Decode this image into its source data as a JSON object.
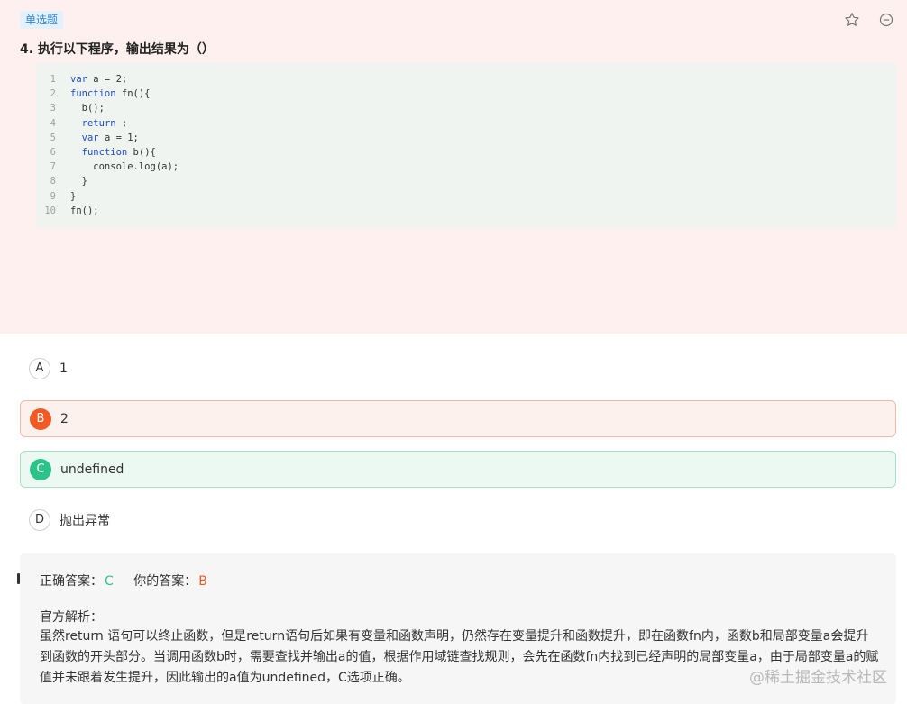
{
  "question": {
    "type_tag": "单选题",
    "title": "4. 执行以下程序，输出结果为（）",
    "code_lines": [
      {
        "num": "1",
        "text": "var a = 2;"
      },
      {
        "num": "2",
        "text": "function fn(){"
      },
      {
        "num": "3",
        "text": "  b();"
      },
      {
        "num": "4",
        "text": "  return ;"
      },
      {
        "num": "5",
        "text": "  var a = 1;"
      },
      {
        "num": "6",
        "text": "  function b(){"
      },
      {
        "num": "7",
        "text": "    console.log(a);"
      },
      {
        "num": "8",
        "text": "  }"
      },
      {
        "num": "9",
        "text": "}"
      },
      {
        "num": "10",
        "text": "fn();"
      }
    ],
    "icons": [
      "star-icon",
      "minus-circle-icon"
    ]
  },
  "options": [
    {
      "letter": "A",
      "text": "1",
      "state": "normal"
    },
    {
      "letter": "B",
      "text": "2",
      "state": "wrong-selected"
    },
    {
      "letter": "C",
      "text": "undefined",
      "state": "correct"
    },
    {
      "letter": "D",
      "text": "抛出异常",
      "state": "normal"
    }
  ],
  "answer": {
    "correct_label": "正确答案：",
    "correct_value": "C",
    "yours_label": "你的答案：",
    "yours_value": "B",
    "analysis_label": "官方解析：",
    "analysis_text": "虽然return 语句可以终止函数，但是return语句后如果有变量和函数声明，仍然存在变量提升和函数提升，即在函数fn内，函数b和局部变量a会提升到函数的开头部分。当调用函数b时，需要查找并输出a的值，根据作用域链查找规则，会先在函数fn内找到已经声明的局部变量a，由于局部变量a的赋值并未跟着发生提升，因此输出的a值为undefined，C选项正确。"
  },
  "watermark": "@稀土掘金技术社区",
  "colors": {
    "question_bg": "#fdf0ef",
    "correct": "#2cc28a",
    "wrong": "#f05a24",
    "tag": "#2f86d6"
  }
}
